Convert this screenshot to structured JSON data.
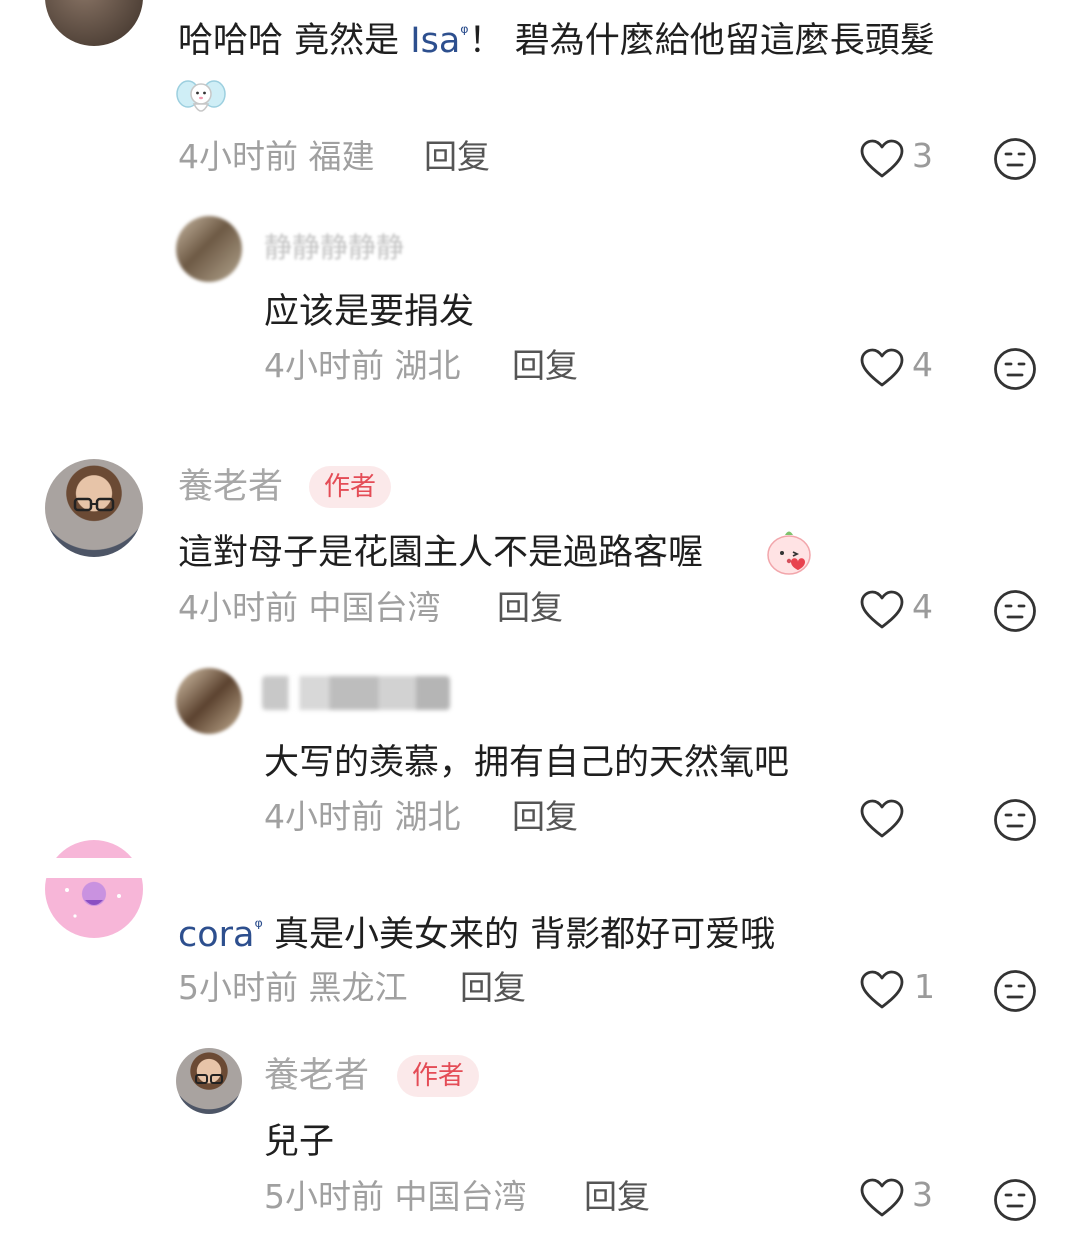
{
  "comments": [
    {
      "id": "c1",
      "text_pre": "哈哈哈 竟然是 ",
      "mention": "Isa",
      "text_post": "！ 碧為什麼給他留這麼長頭髮",
      "time": "4小时前",
      "location": "福建",
      "reply_label": "回复",
      "likes": "3"
    },
    {
      "id": "c2",
      "name": "静静静静静",
      "text": "应该是要捐发",
      "time": "4小时前",
      "location": "湖北",
      "reply_label": "回复",
      "likes": "4"
    },
    {
      "id": "c3",
      "name": "養老者",
      "badge": "作者",
      "text": "這對母子是花園主人不是過路客喔",
      "time": "4小时前",
      "location": "中国台湾",
      "reply_label": "回复",
      "likes": "4"
    },
    {
      "id": "c4",
      "text": "大写的羡慕，拥有自己的天然氧吧",
      "time": "4小时前",
      "location": "湖北",
      "reply_label": "回复",
      "likes": ""
    },
    {
      "id": "c5",
      "mention": "cora",
      "text": " 真是小美女来的 背影都好可爱哦",
      "time": "5小时前",
      "location": "黑龙江",
      "reply_label": "回复",
      "likes": "1"
    },
    {
      "id": "c6",
      "name": "養老者",
      "badge": "作者",
      "text": "兒子",
      "time": "5小时前",
      "location": "中国台湾",
      "reply_label": "回复",
      "likes": "3"
    }
  ],
  "colors": {
    "mention": "#2d4f8e",
    "badge_text": "#e44c56",
    "badge_bg": "#fbe9ea",
    "meta": "#a0a0a0"
  },
  "icons": {
    "like": "heart-outline-icon",
    "dislike": "neutral-face-icon"
  }
}
